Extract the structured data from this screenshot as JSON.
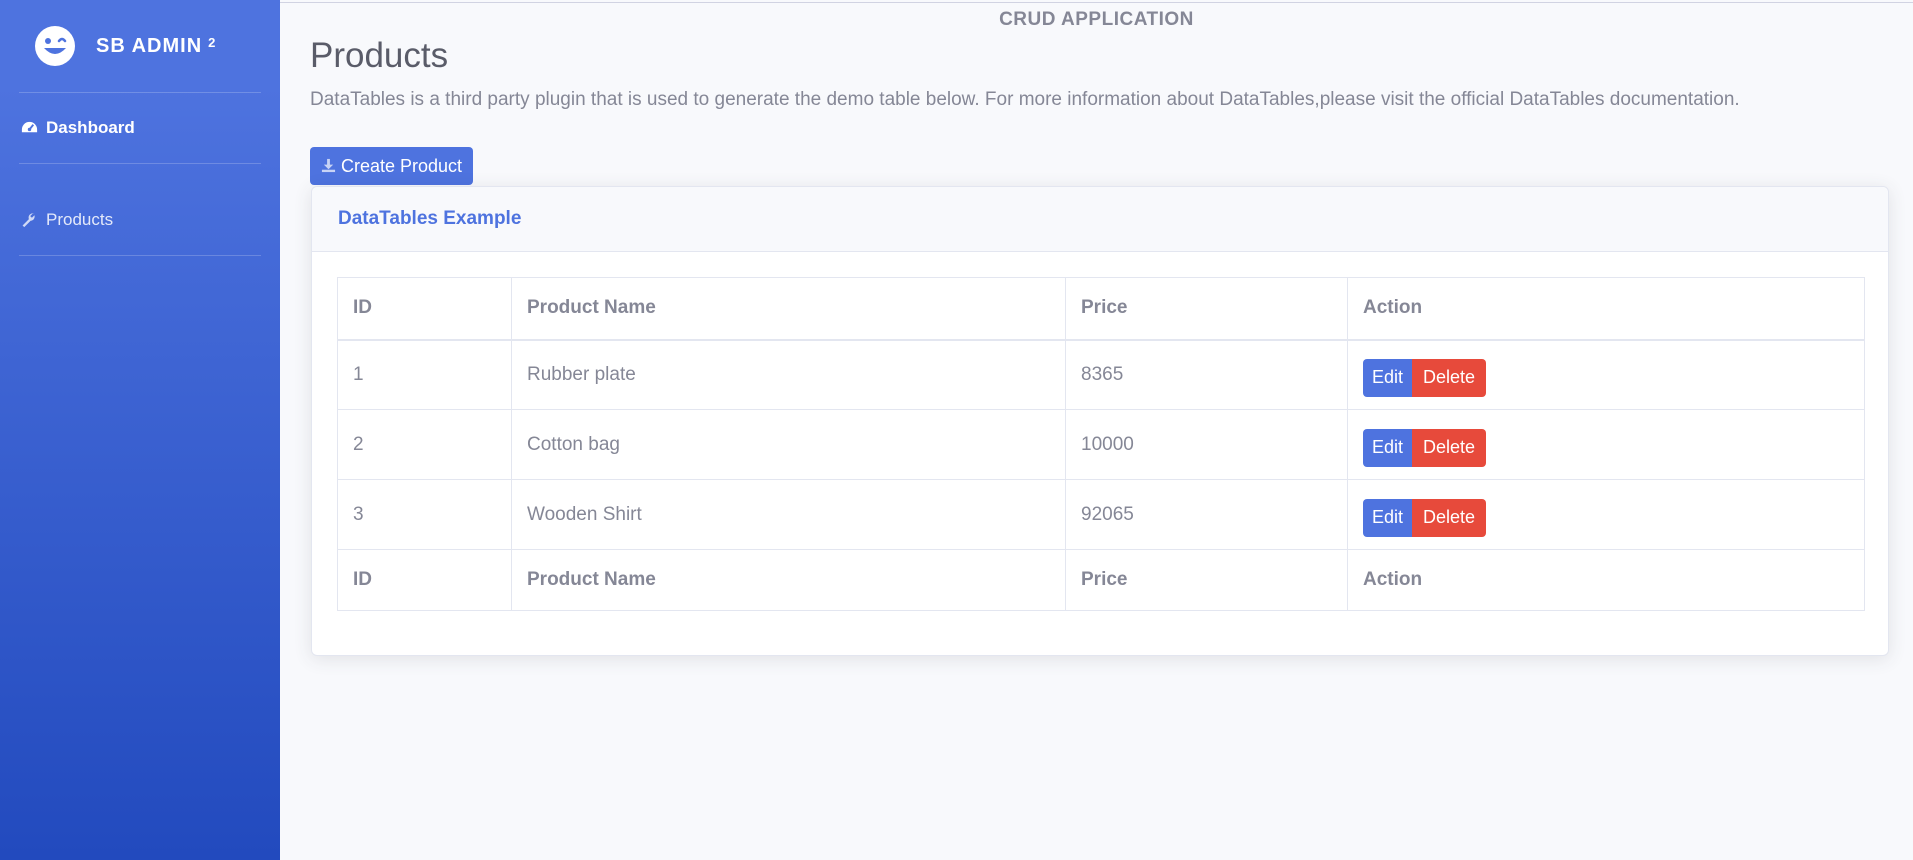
{
  "sidebar": {
    "brand": "SB ADMIN",
    "brand_sup": "2",
    "items": [
      {
        "label": "Dashboard",
        "icon": "tachometer-icon"
      },
      {
        "label": "Products",
        "icon": "wrench-icon"
      }
    ]
  },
  "header": {
    "app_title": "CRUD APPLICATION",
    "page_title": "Products",
    "description": "DataTables is a third party plugin that is used to generate the demo table below. For more information about DataTables,please visit the official DataTables documentation."
  },
  "toolbar": {
    "create_label": "Create Product",
    "create_icon": "download-icon"
  },
  "card": {
    "title": "DataTables Example"
  },
  "table": {
    "columns": [
      "ID",
      "Product Name",
      "Price",
      "Action"
    ],
    "rows": [
      {
        "id": "1",
        "name": "Rubber plate",
        "price": "8365"
      },
      {
        "id": "2",
        "name": "Cotton bag",
        "price": "10000"
      },
      {
        "id": "3",
        "name": "Wooden Shirt",
        "price": "92065"
      }
    ],
    "edit_label": "Edit",
    "delete_label": "Delete"
  },
  "colors": {
    "primary": "#4e73df",
    "danger": "#e74a3b",
    "text_muted": "#858796"
  }
}
